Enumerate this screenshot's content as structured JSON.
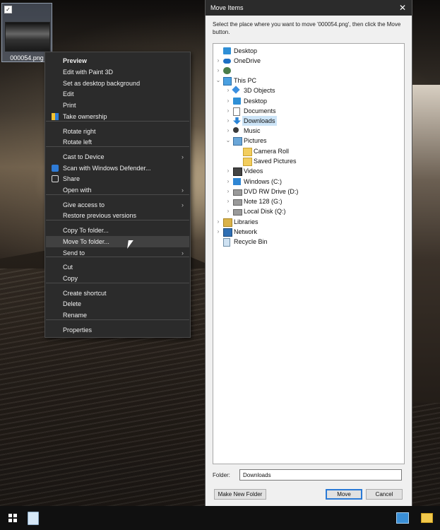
{
  "desktop": {
    "icon_label": "000054.png",
    "icon_checked": "✓"
  },
  "context_menu": {
    "items": [
      {
        "label": "Preview",
        "bold": true
      },
      {
        "label": "Edit with Paint 3D"
      },
      {
        "label": "Set as desktop background"
      },
      {
        "label": "Edit"
      },
      {
        "label": "Print"
      },
      {
        "label": "Take ownership",
        "icon": "shield-icon"
      },
      {
        "label": "Rotate right"
      },
      {
        "label": "Rotate left"
      },
      {
        "label": "Cast to Device",
        "submenu": true
      },
      {
        "label": "Scan with Windows Defender...",
        "icon": "defender-icon"
      },
      {
        "label": "Share",
        "icon": "share-icon"
      },
      {
        "label": "Open with",
        "submenu": true
      },
      {
        "label": "Give access to",
        "submenu": true
      },
      {
        "label": "Restore previous versions"
      },
      {
        "label": "Copy To folder..."
      },
      {
        "label": "Move To folder...",
        "highlighted": true
      },
      {
        "label": "Send to",
        "submenu": true
      },
      {
        "label": "Cut"
      },
      {
        "label": "Copy"
      },
      {
        "label": "Create shortcut"
      },
      {
        "label": "Delete"
      },
      {
        "label": "Rename"
      },
      {
        "label": "Properties"
      }
    ],
    "submenu_arrow": "›"
  },
  "dialog": {
    "title": "Move Items",
    "close": "✕",
    "instructions": "Select the place where you want to move '000054.png', then click the Move button.",
    "tree": [
      {
        "label": "Desktop",
        "icon": "desktop-icon",
        "chev": ""
      },
      {
        "label": "OneDrive",
        "icon": "onedrive-icon",
        "chev": "›"
      },
      {
        "label": "",
        "icon": "user-icon",
        "chev": "›"
      },
      {
        "label": "This PC",
        "icon": "pc-icon",
        "chev": "⌄"
      },
      {
        "label": "3D Objects",
        "icon": "3d-objects-icon",
        "chev": "›"
      },
      {
        "label": "Desktop",
        "icon": "desktop-folder-icon",
        "chev": "›"
      },
      {
        "label": "Documents",
        "icon": "documents-icon",
        "chev": "›"
      },
      {
        "label": "Downloads",
        "icon": "downloads-icon",
        "chev": "›",
        "selected": true
      },
      {
        "label": "Music",
        "icon": "music-icon",
        "chev": "›"
      },
      {
        "label": "Pictures",
        "icon": "pictures-icon",
        "chev": "⌄"
      },
      {
        "label": "Camera Roll",
        "icon": "folder-icon",
        "chev": ""
      },
      {
        "label": "Saved Pictures",
        "icon": "folder-icon",
        "chev": ""
      },
      {
        "label": "Videos",
        "icon": "videos-icon",
        "chev": "›"
      },
      {
        "label": "Windows (C:)",
        "icon": "windows-drive-icon",
        "chev": "›"
      },
      {
        "label": "DVD RW Drive (D:)",
        "icon": "dvd-drive-icon",
        "chev": "›"
      },
      {
        "label": "Note 128 (G:)",
        "icon": "drive-icon",
        "chev": "›"
      },
      {
        "label": "Local Disk (Q:)",
        "icon": "drive-icon",
        "chev": "›"
      },
      {
        "label": "Libraries",
        "icon": "libraries-icon",
        "chev": "›"
      },
      {
        "label": "Network",
        "icon": "network-icon",
        "chev": "›"
      },
      {
        "label": "Recycle Bin",
        "icon": "recycle-bin-icon",
        "chev": ""
      }
    ],
    "folder_label": "Folder:",
    "folder_value": "Downloads",
    "make_new_folder": "Make New Folder",
    "move": "Move",
    "cancel": "Cancel"
  },
  "taskbar": {
    "items": [
      "start-icon",
      "recycle-bin-icon",
      "app-icon",
      "file-explorer-icon"
    ]
  }
}
